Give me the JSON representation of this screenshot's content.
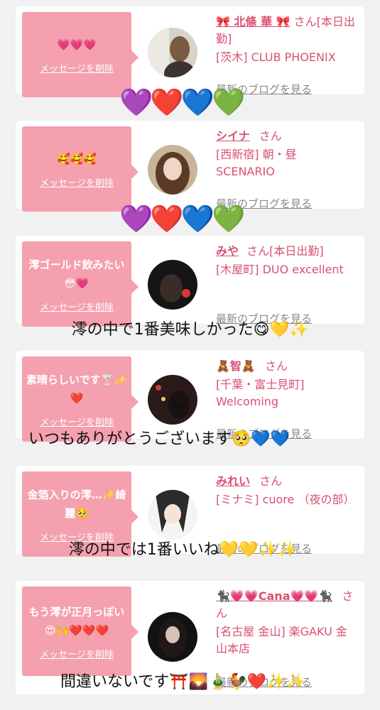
{
  "common": {
    "san": "さん",
    "delete": "メッセージを削除",
    "blog": "最新のブログを見る"
  },
  "cards": [
    {
      "message": "💗💗💗",
      "name": "🎀 北條 華 🎀",
      "suffix": "さん[本日出勤]",
      "shop": "[茨木] CLUB PHOENIX"
    },
    {
      "message": "🥰🥰🥰",
      "name": "シイナ",
      "suffix": "さん",
      "shop": "[西新宿] 朝・昼 SCENARIO"
    },
    {
      "message": "澪ゴールド飲みたい😳💗",
      "name": "みや",
      "suffix": "さん[本日出勤]",
      "shop": "[木屋町] DUO excellent"
    },
    {
      "message": "素晴らしいです🍸✨❤️",
      "name": "🧸智🧸",
      "suffix": "さん",
      "shop": "[千葉・富士見町] Welcoming"
    },
    {
      "message": "金箔入りの澪…✨綺麗🥺",
      "name": "みれい",
      "suffix": "さん",
      "shop": "[ミナミ] cuore （夜の部）"
    },
    {
      "message": "もう澪が正月っぽい😍🙌❤️❤️❤️",
      "name": "🐈‍⬛💗💗Cana💗💗🐈‍⬛",
      "suffix": "さん",
      "shop": "[名古屋 金山] 楽GAKU 金山本店"
    }
  ],
  "overlays": {
    "hearts1": "💜❤️💙💚",
    "hearts2": "💜❤️💙💚",
    "line3": "澪の中で1番美味しかった😋💛✨",
    "line4": "いつもありがとうございます🥺💙💙",
    "line5": "澪の中では1番いいね💛💛✨✨",
    "line6": "間違いないです⛩️🌄🎍🐓❤️✨✨"
  }
}
